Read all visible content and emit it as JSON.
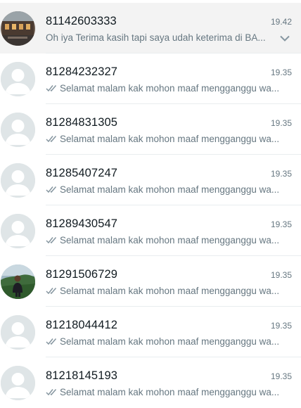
{
  "chats": [
    {
      "name": "81142603333",
      "time": "19.42",
      "preview": "Oh iya Terima kasih tapi saya udah keterima di BA...",
      "ticks": false,
      "avatar": "photo-building",
      "active": true
    },
    {
      "name": "81284232327",
      "time": "19.35",
      "preview": "Selamat malam kak mohon maaf mengganggu wa...",
      "ticks": true,
      "avatar": "default"
    },
    {
      "name": "81284831305",
      "time": "19.35",
      "preview": "Selamat malam kak mohon maaf mengganggu wa...",
      "ticks": true,
      "avatar": "default"
    },
    {
      "name": "81285407247",
      "time": "19.35",
      "preview": "Selamat malam kak mohon maaf mengganggu wa...",
      "ticks": true,
      "avatar": "default"
    },
    {
      "name": "81289430547",
      "time": "19.35",
      "preview": "Selamat malam kak mohon maaf mengganggu wa...",
      "ticks": true,
      "avatar": "default"
    },
    {
      "name": "81291506729",
      "time": "19.35",
      "preview": "Selamat malam kak mohon maaf mengganggu wa...",
      "ticks": true,
      "avatar": "photo-person"
    },
    {
      "name": "81218044412",
      "time": "19.35",
      "preview": "Selamat malam kak mohon maaf mengganggu wa...",
      "ticks": true,
      "avatar": "default"
    },
    {
      "name": "81218145193",
      "time": "19.35",
      "preview": "Selamat malam kak mohon maaf mengganggu wa...",
      "ticks": true,
      "avatar": "default"
    }
  ],
  "colors": {
    "tick": "#8696a0",
    "name": "#111b21",
    "meta": "#667781",
    "active_bg": "#f3f3f3"
  },
  "icons": {
    "tick": "double-check-icon",
    "chevron": "chevron-down-icon",
    "avatar_default": "default-avatar-icon"
  }
}
